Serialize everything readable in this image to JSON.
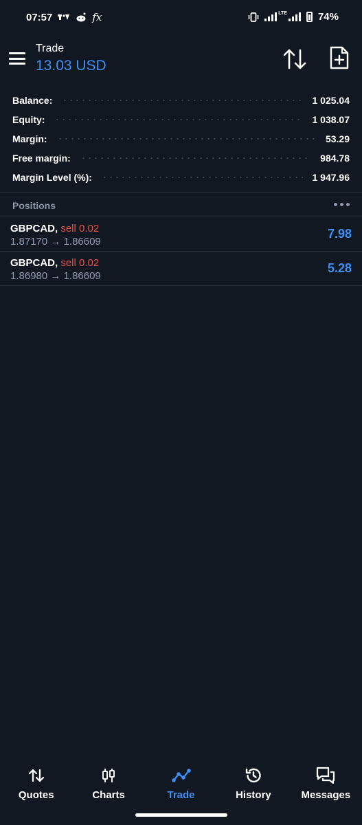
{
  "status_bar": {
    "time": "07:57",
    "fx_label": "fx",
    "network_label": "LTE",
    "battery_percent": "74%"
  },
  "header": {
    "title": "Trade",
    "subtitle": "13.03 USD"
  },
  "summary": [
    {
      "label": "Balance:",
      "value": "1 025.04"
    },
    {
      "label": "Equity:",
      "value": "1 038.07"
    },
    {
      "label": "Margin:",
      "value": "53.29"
    },
    {
      "label": "Free margin:",
      "value": "984.78"
    },
    {
      "label": "Margin Level (%):",
      "value": "1 947.96"
    }
  ],
  "positions": {
    "title": "Positions",
    "items": [
      {
        "symbol": "GBPCAD,",
        "side": "sell 0.02",
        "prices": "1.87170 → 1.86609",
        "profit": "7.98"
      },
      {
        "symbol": "GBPCAD,",
        "side": "sell 0.02",
        "prices": "1.86980 → 1.86609",
        "profit": "5.28"
      }
    ]
  },
  "nav": {
    "items": [
      {
        "label": "Quotes",
        "icon": "quotes-arrows-icon"
      },
      {
        "label": "Charts",
        "icon": "candlestick-icon"
      },
      {
        "label": "Trade",
        "icon": "trade-line-icon"
      },
      {
        "label": "History",
        "icon": "history-icon"
      },
      {
        "label": "Messages",
        "icon": "messages-icon"
      }
    ],
    "active": "Trade"
  },
  "colors": {
    "background": "#111821",
    "accent": "#3d8ef5",
    "sell": "#e8504a",
    "muted": "#8e9db3"
  }
}
